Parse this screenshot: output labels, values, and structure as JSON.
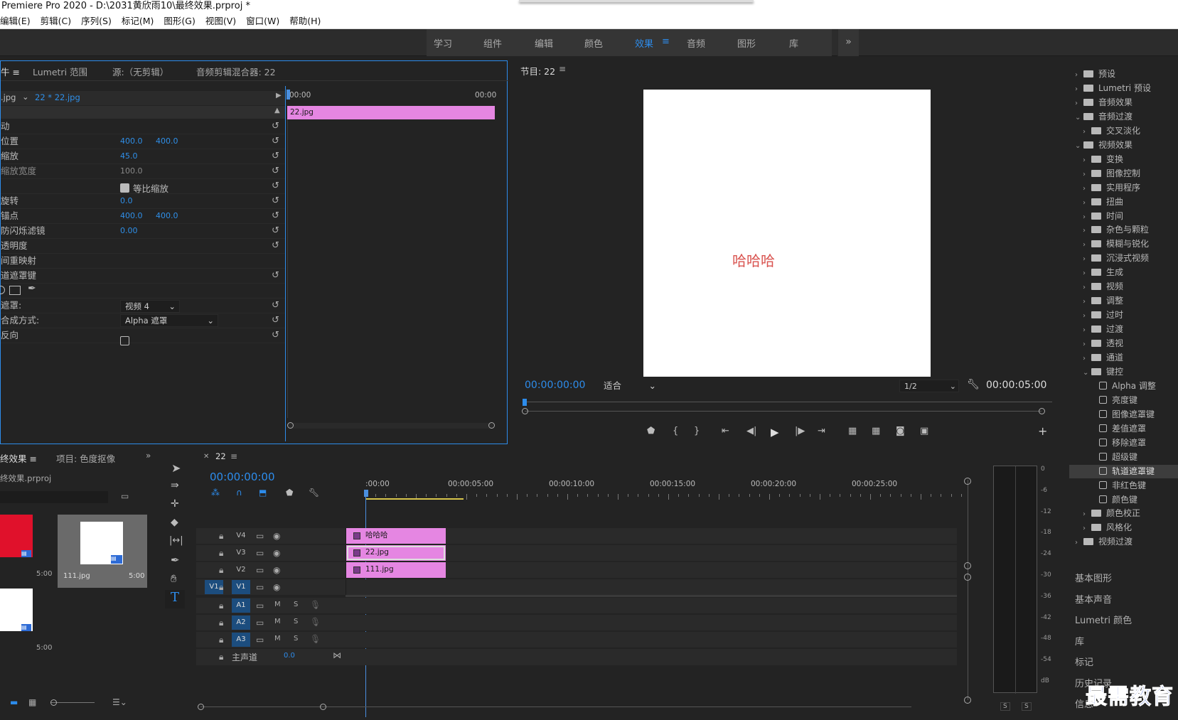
{
  "app": {
    "title": "Premiere Pro 2020 - D:\\2031黄欣雨10\\最终效果.prproj *"
  },
  "menu": [
    "编辑(E)",
    "剪辑(C)",
    "序列(S)",
    "标记(M)",
    "图形(G)",
    "视图(V)",
    "窗口(W)",
    "帮助(H)"
  ],
  "workspaces": {
    "items": [
      "学习",
      "组件",
      "编辑",
      "颜色",
      "效果",
      "音频",
      "图形",
      "库"
    ],
    "active": "效果",
    "more": "»"
  },
  "effect_controls": {
    "tabs": [
      "Lumetri 范围",
      "源:（无剪辑）",
      "音频剪辑混合器: 22"
    ],
    "clip_prefix": ".jpg",
    "clip_name": "22 * 22.jpg",
    "time_start": "00:00",
    "time_end": "00:00",
    "clip_bar": "22.jpg",
    "rows": [
      {
        "label": "动",
        "v1": "",
        "v2": ""
      },
      {
        "label": "位置",
        "v1": "400.0",
        "v2": "400.0"
      },
      {
        "label": "缩放",
        "v1": "45.0",
        "v2": ""
      },
      {
        "label": "缩放宽度",
        "v1": "100.0",
        "v2": ""
      },
      {
        "label": "",
        "v1": "",
        "v2": ""
      },
      {
        "label": "旋转",
        "v1": "0.0",
        "v2": ""
      },
      {
        "label": "锚点",
        "v1": "400.0",
        "v2": "400.0"
      },
      {
        "label": "防闪烁滤镜",
        "v1": "0.00",
        "v2": ""
      },
      {
        "label": "透明度",
        "v1": "",
        "v2": ""
      },
      {
        "label": "间重映射",
        "v1": "",
        "v2": ""
      },
      {
        "label": "道遮罩键",
        "v1": "",
        "v2": ""
      },
      {
        "label": "",
        "v1": "",
        "v2": ""
      },
      {
        "label": "遮罩:",
        "v1": "",
        "v2": ""
      },
      {
        "label": "合成方式:",
        "v1": "",
        "v2": ""
      },
      {
        "label": "反向",
        "v1": "",
        "v2": ""
      }
    ],
    "uniform_scale": "等比缩放",
    "mask_select": "视频 4",
    "composite_select": "Alpha 遮罩"
  },
  "program": {
    "title": "节目: 22",
    "overlay_text": "哈哈哈",
    "timecode": "00:00:00:00",
    "fit": "适合",
    "resolution": "1/2",
    "duration": "00:00:05:00"
  },
  "project": {
    "tabs": [
      "终效果",
      "项目: 色度抠像"
    ],
    "file": "终效果.prproj",
    "items": [
      {
        "name": "",
        "dur": "5:00"
      },
      {
        "name": "111.jpg",
        "dur": "5:00"
      },
      {
        "name": "",
        "dur": "5:00"
      }
    ]
  },
  "timeline": {
    "seq": "22",
    "timecode": "00:00:00:00",
    "ruler": [
      ":00:00",
      "00:00:05:00",
      "00:00:10:00",
      "00:00:15:00",
      "00:00:20:00",
      "00:00:25:00"
    ],
    "video_tracks": [
      "V4",
      "V3",
      "V2",
      "V1"
    ],
    "audio_tracks": [
      "A1",
      "A2",
      "A3"
    ],
    "source_patch": "V1",
    "master": "主声道",
    "master_val": "0.0",
    "clips": [
      {
        "track": "V4",
        "name": "哈哈哈"
      },
      {
        "track": "V3",
        "name": "22.jpg"
      },
      {
        "track": "V2",
        "name": "111.jpg"
      }
    ]
  },
  "effects_tree": [
    {
      "label": "预设",
      "level": 0,
      "icon": "folder-star",
      "open": false
    },
    {
      "label": "Lumetri 预设",
      "level": 0,
      "icon": "folder-star",
      "open": false
    },
    {
      "label": "音频效果",
      "level": 0,
      "icon": "folder",
      "open": false
    },
    {
      "label": "音频过渡",
      "level": 0,
      "icon": "folder",
      "open": true
    },
    {
      "label": "交叉淡化",
      "level": 1,
      "icon": "folder",
      "open": false
    },
    {
      "label": "视频效果",
      "level": 0,
      "icon": "folder",
      "open": true
    },
    {
      "label": "变换",
      "level": 1,
      "icon": "folder",
      "open": false
    },
    {
      "label": "图像控制",
      "level": 1,
      "icon": "folder",
      "open": false
    },
    {
      "label": "实用程序",
      "level": 1,
      "icon": "folder",
      "open": false
    },
    {
      "label": "扭曲",
      "level": 1,
      "icon": "folder",
      "open": false
    },
    {
      "label": "时间",
      "level": 1,
      "icon": "folder",
      "open": false
    },
    {
      "label": "杂色与颗粒",
      "level": 1,
      "icon": "folder",
      "open": false
    },
    {
      "label": "模糊与锐化",
      "level": 1,
      "icon": "folder",
      "open": false
    },
    {
      "label": "沉浸式视频",
      "level": 1,
      "icon": "folder",
      "open": false
    },
    {
      "label": "生成",
      "level": 1,
      "icon": "folder",
      "open": false
    },
    {
      "label": "视频",
      "level": 1,
      "icon": "folder",
      "open": false
    },
    {
      "label": "调整",
      "level": 1,
      "icon": "folder",
      "open": false
    },
    {
      "label": "过时",
      "level": 1,
      "icon": "folder",
      "open": false
    },
    {
      "label": "过渡",
      "level": 1,
      "icon": "folder",
      "open": false
    },
    {
      "label": "透视",
      "level": 1,
      "icon": "folder",
      "open": false
    },
    {
      "label": "通道",
      "level": 1,
      "icon": "folder",
      "open": false
    },
    {
      "label": "键控",
      "level": 1,
      "icon": "folder",
      "open": true
    },
    {
      "label": "Alpha 调整",
      "level": 2,
      "icon": "effect"
    },
    {
      "label": "亮度键",
      "level": 2,
      "icon": "effect"
    },
    {
      "label": "图像遮罩键",
      "level": 2,
      "icon": "effect"
    },
    {
      "label": "差值遮罩",
      "level": 2,
      "icon": "effect"
    },
    {
      "label": "移除遮罩",
      "level": 2,
      "icon": "effect"
    },
    {
      "label": "超级键",
      "level": 2,
      "icon": "effect"
    },
    {
      "label": "轨道遮罩键",
      "level": 2,
      "icon": "effect",
      "selected": true
    },
    {
      "label": "非红色键",
      "level": 2,
      "icon": "effect"
    },
    {
      "label": "颜色键",
      "level": 2,
      "icon": "effect"
    },
    {
      "label": "颜色校正",
      "level": 1,
      "icon": "folder",
      "open": false
    },
    {
      "label": "风格化",
      "level": 1,
      "icon": "folder",
      "open": false
    },
    {
      "label": "视频过渡",
      "level": 0,
      "icon": "folder",
      "open": false
    }
  ],
  "right_panels": [
    "基本图形",
    "基本声音",
    "Lumetri 颜色",
    "库",
    "标记",
    "历史记录",
    "信息"
  ],
  "meter": {
    "labels": [
      "0",
      "-6",
      "-12",
      "-18",
      "-24",
      "-30",
      "-36",
      "-42",
      "-48",
      "-54",
      "dB"
    ],
    "solo": [
      "S",
      "S"
    ]
  },
  "watermark": "最需教育",
  "colors": {
    "accent": "#2d8ceb",
    "clip": "#e586e2",
    "overlay_text": "#d9534f"
  }
}
